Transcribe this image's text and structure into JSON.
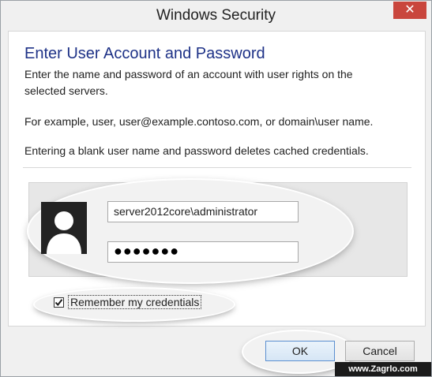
{
  "window": {
    "title": "Windows Security",
    "close_icon": "✕"
  },
  "content": {
    "heading": "Enter User Account and Password",
    "instructions_line1": "Enter the name and password of an account with user rights on the",
    "instructions_line2": "selected servers.",
    "example": "For example, user, user@example.contoso.com, or domain\\user name.",
    "blank_note": "Entering a blank user name and password deletes cached credentials."
  },
  "credentials": {
    "avatar_icon": "user-avatar-icon",
    "username_value": "server2012core\\administrator",
    "password_value": "●●●●●●●"
  },
  "remember": {
    "checked": true,
    "label": "Remember my credentials"
  },
  "buttons": {
    "ok_label": "OK",
    "cancel_label": "Cancel"
  },
  "watermark": "www.Zagrlo.com",
  "colors": {
    "heading": "#1e3287",
    "close_button": "#c9463d",
    "ok_border": "#5b8fd0"
  }
}
